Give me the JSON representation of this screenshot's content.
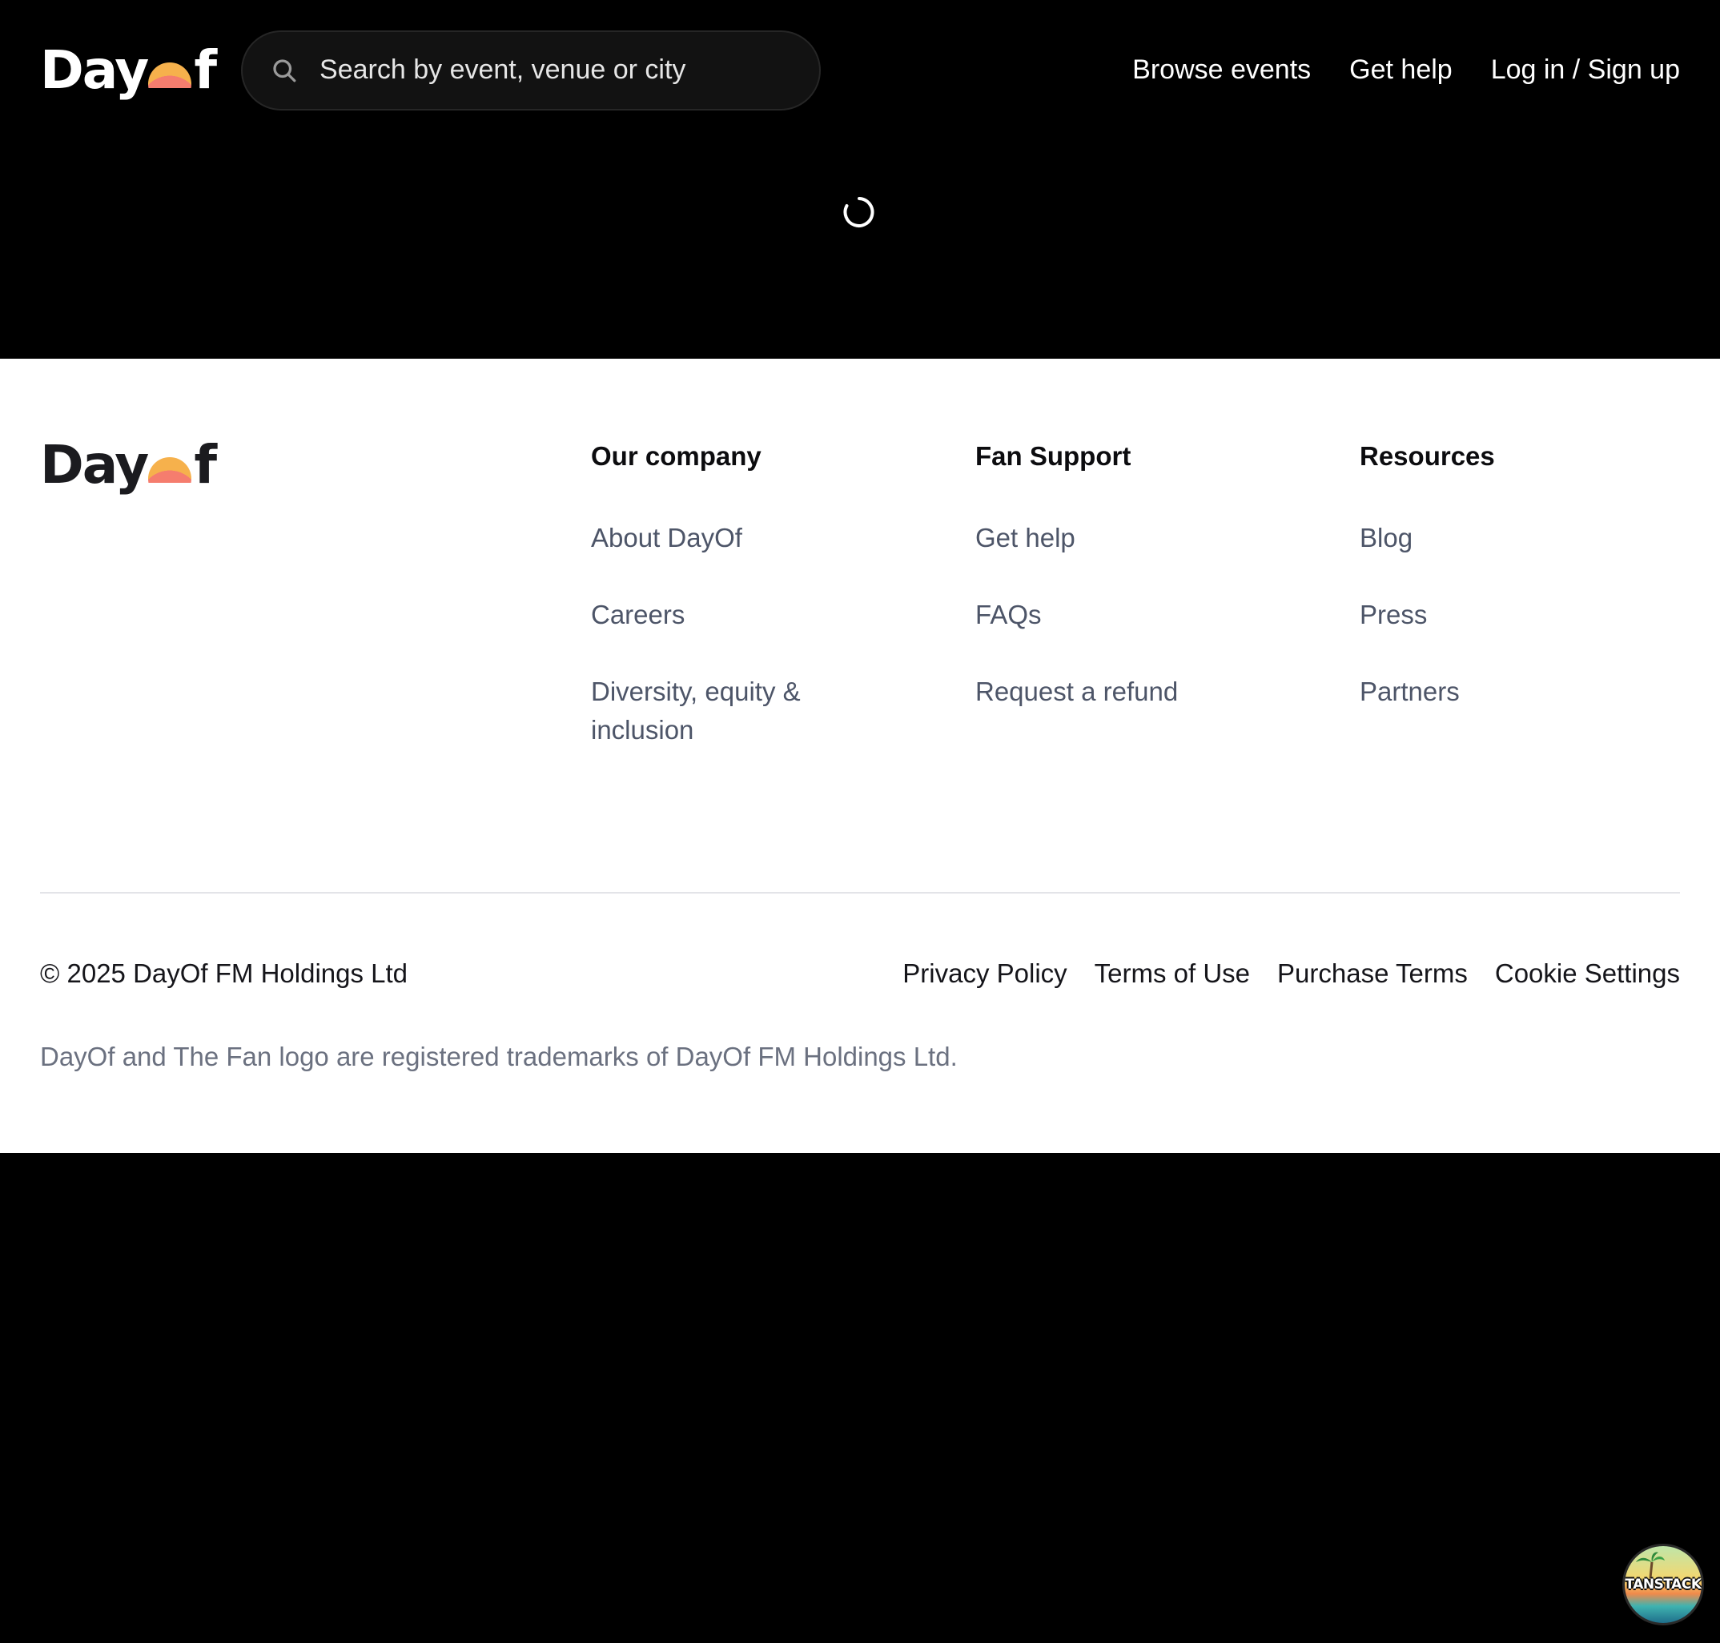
{
  "header": {
    "logo": {
      "prefix": "Day",
      "suffix": "f"
    },
    "search": {
      "placeholder": "Search by event, venue or city"
    },
    "nav": [
      {
        "label": "Browse events"
      },
      {
        "label": "Get help"
      },
      {
        "label": "Log in / Sign up"
      }
    ]
  },
  "footer": {
    "logo": {
      "prefix": "Day",
      "suffix": "f"
    },
    "columns": [
      {
        "title": "Our company",
        "links": [
          "About DayOf",
          "Careers",
          "Diversity, equity & inclusion"
        ]
      },
      {
        "title": "Fan Support",
        "links": [
          "Get help",
          "FAQs",
          "Request a refund"
        ]
      },
      {
        "title": "Resources",
        "links": [
          "Blog",
          "Press",
          "Partners"
        ]
      }
    ],
    "copyright": "© 2025 DayOf FM Holdings Ltd",
    "legal_links": [
      "Privacy Policy",
      "Terms of Use",
      "Purchase Terms",
      "Cookie Settings"
    ],
    "trademark": "DayOf and The Fan logo are registered trademarks of DayOf FM Holdings Ltd."
  },
  "devtools": {
    "label": "TANSTACK"
  },
  "colors": {
    "background": "#000000",
    "footer_background": "#ffffff",
    "link_muted": "#4d5568",
    "logo_sun": [
      "#f6b14c",
      "#f57d6e",
      "#f79aa6"
    ]
  }
}
